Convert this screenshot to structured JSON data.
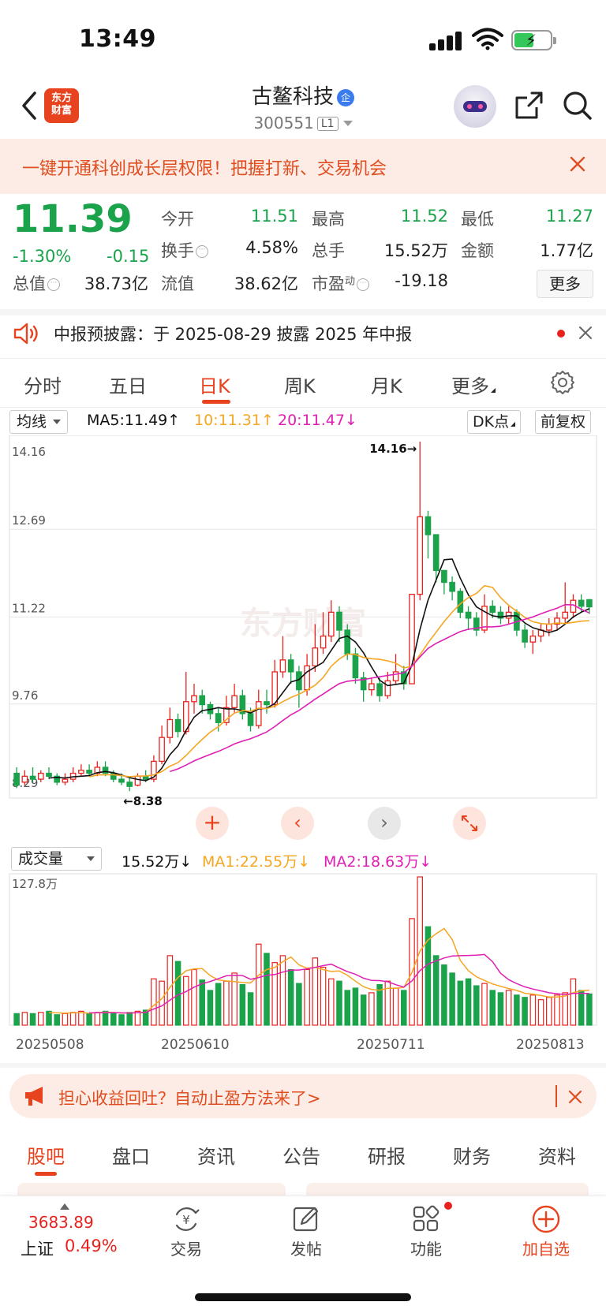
{
  "status_bar": {
    "time": "13:49"
  },
  "header": {
    "logo_text_1": "东方",
    "logo_text_2": "财富",
    "stock_name": "古鳌科技",
    "badge": "企",
    "stock_code": "300551",
    "level": "L1"
  },
  "promo": {
    "text": "一键开通科创成长层权限！把握打新、交易机会"
  },
  "quote": {
    "price": "11.39",
    "change_pct": "-1.30%",
    "change_abs": "-0.15",
    "fields": [
      {
        "label": "今开",
        "value": "11.51",
        "color": "green"
      },
      {
        "label": "最高",
        "value": "11.52",
        "color": "green"
      },
      {
        "label": "最低",
        "value": "11.27",
        "color": "green"
      },
      {
        "label": "换手",
        "value": "4.58%",
        "color": "dark"
      },
      {
        "label": "总手",
        "value": "15.52万",
        "color": "dark"
      },
      {
        "label": "金额",
        "value": "1.77亿",
        "color": "dark"
      },
      {
        "label": "总值",
        "value": "38.73亿",
        "color": "dark"
      },
      {
        "label": "流值",
        "value": "38.62亿",
        "color": "dark"
      },
      {
        "label": "市盈",
        "label_sup": "动",
        "value": "-19.18",
        "color": "dark"
      }
    ],
    "more_label": "更多"
  },
  "notice": {
    "text": "中报预披露：于 2025-08-29 披露 2025 年中报"
  },
  "tabs": [
    "分时",
    "五日",
    "日K",
    "周K",
    "月K",
    "更多"
  ],
  "active_tab": "日K",
  "chart_controls": {
    "indicator_select": "均线",
    "ma5": "MA5:11.49",
    "ma10": "10:11.31",
    "ma20": "20:11.47",
    "dk_button": "DK点",
    "adjust_button": "前复权",
    "volume_select": "成交量",
    "vol_value": "15.52万",
    "vol_ma1": "MA1:22.55万",
    "vol_ma2": "MA2:18.63万",
    "watermark": "东方财富"
  },
  "chart_data": {
    "type": "candlestick",
    "y_ticks": [
      "14.16",
      "12.69",
      "11.22",
      "9.76",
      "8.29"
    ],
    "ylim": [
      8.29,
      14.16
    ],
    "high_label": "14.16",
    "low_label": "8.38",
    "volume_max_label": "127.8万",
    "x_ticks": [
      "20250508",
      "20250610",
      "20250711",
      "20250813"
    ],
    "ohlc": [
      [
        8.6,
        8.4,
        8.7,
        8.35
      ],
      [
        8.45,
        8.55,
        8.65,
        8.4
      ],
      [
        8.55,
        8.5,
        8.7,
        8.45
      ],
      [
        8.5,
        8.6,
        8.65,
        8.45
      ],
      [
        8.6,
        8.55,
        8.7,
        8.5
      ],
      [
        8.55,
        8.45,
        8.6,
        8.4
      ],
      [
        8.45,
        8.5,
        8.6,
        8.4
      ],
      [
        8.5,
        8.6,
        8.7,
        8.45
      ],
      [
        8.6,
        8.65,
        8.75,
        8.55
      ],
      [
        8.65,
        8.6,
        8.75,
        8.55
      ],
      [
        8.6,
        8.7,
        8.8,
        8.55
      ],
      [
        8.7,
        8.6,
        8.8,
        8.55
      ],
      [
        8.6,
        8.5,
        8.65,
        8.45
      ],
      [
        8.5,
        8.45,
        8.6,
        8.4
      ],
      [
        8.45,
        8.38,
        8.55,
        8.3
      ],
      [
        8.4,
        8.55,
        8.6,
        8.38
      ],
      [
        8.55,
        8.5,
        8.65,
        8.45
      ],
      [
        8.5,
        8.8,
        8.9,
        8.45
      ],
      [
        8.8,
        9.2,
        9.4,
        8.75
      ],
      [
        9.2,
        9.5,
        9.7,
        9.1
      ],
      [
        9.5,
        9.3,
        9.6,
        9.2
      ],
      [
        9.3,
        9.8,
        10.3,
        9.25
      ],
      [
        9.8,
        9.9,
        10.1,
        9.6
      ],
      [
        9.9,
        9.75,
        10.0,
        9.6
      ],
      [
        9.75,
        9.6,
        9.8,
        9.5
      ],
      [
        9.6,
        9.45,
        9.7,
        9.3
      ],
      [
        9.45,
        9.7,
        9.9,
        9.4
      ],
      [
        9.7,
        9.9,
        10.1,
        9.6
      ],
      [
        9.9,
        9.6,
        10.0,
        9.5
      ],
      [
        9.6,
        9.4,
        9.7,
        9.3
      ],
      [
        9.4,
        9.8,
        10.0,
        9.35
      ],
      [
        9.8,
        9.75,
        10.0,
        9.6
      ],
      [
        9.75,
        10.3,
        10.5,
        9.7
      ],
      [
        10.3,
        10.5,
        10.9,
        10.2
      ],
      [
        10.5,
        10.3,
        10.6,
        10.1
      ],
      [
        10.3,
        10.0,
        10.4,
        9.7
      ],
      [
        10.0,
        10.4,
        10.6,
        9.9
      ],
      [
        10.4,
        10.7,
        11.1,
        10.3
      ],
      [
        10.7,
        10.9,
        11.3,
        10.6
      ],
      [
        10.9,
        11.3,
        11.5,
        10.8
      ],
      [
        11.3,
        11.0,
        11.4,
        10.8
      ],
      [
        11.0,
        10.6,
        11.1,
        10.5
      ],
      [
        10.6,
        10.2,
        10.7,
        10.1
      ],
      [
        10.2,
        10.0,
        10.3,
        9.8
      ],
      [
        10.0,
        10.1,
        10.2,
        9.9
      ],
      [
        10.1,
        9.9,
        10.2,
        9.8
      ],
      [
        9.9,
        10.15,
        10.3,
        9.85
      ],
      [
        10.15,
        10.3,
        10.6,
        10.1
      ],
      [
        10.3,
        10.1,
        10.4,
        10.0
      ],
      [
        10.1,
        11.6,
        11.6,
        10.1
      ],
      [
        11.6,
        12.9,
        14.16,
        11.5
      ],
      [
        12.9,
        12.6,
        13.0,
        12.2
      ],
      [
        12.6,
        12.0,
        12.2,
        11.8
      ],
      [
        12.0,
        11.8,
        12.0,
        11.6
      ],
      [
        11.8,
        11.65,
        11.9,
        11.5
      ],
      [
        11.65,
        11.3,
        11.7,
        11.2
      ],
      [
        11.3,
        11.2,
        11.4,
        11.0
      ],
      [
        11.2,
        11.0,
        11.3,
        10.9
      ],
      [
        11.0,
        11.4,
        11.6,
        10.95
      ],
      [
        11.4,
        11.3,
        11.5,
        11.2
      ],
      [
        11.3,
        11.2,
        11.4,
        11.1
      ],
      [
        11.2,
        11.3,
        11.4,
        11.1
      ],
      [
        11.3,
        11.0,
        11.35,
        10.9
      ],
      [
        11.0,
        10.8,
        11.1,
        10.7
      ],
      [
        10.8,
        10.9,
        11.0,
        10.6
      ],
      [
        10.9,
        11.0,
        11.1,
        10.8
      ],
      [
        11.0,
        11.1,
        11.2,
        10.9
      ],
      [
        11.1,
        11.2,
        11.3,
        11.0
      ],
      [
        11.2,
        11.3,
        11.8,
        11.1
      ],
      [
        11.3,
        11.5,
        11.6,
        11.2
      ],
      [
        11.5,
        11.4,
        11.6,
        11.3
      ],
      [
        11.51,
        11.39,
        11.52,
        11.27
      ]
    ],
    "volume": [
      10,
      11,
      10,
      11,
      12,
      9,
      10,
      11,
      12,
      10,
      11,
      12,
      10,
      9,
      11,
      12,
      13,
      40,
      38,
      60,
      55,
      42,
      48,
      39,
      30,
      36,
      38,
      45,
      35,
      28,
      70,
      62,
      54,
      60,
      48,
      36,
      48,
      58,
      50,
      40,
      38,
      30,
      32,
      26,
      28,
      35,
      38,
      32,
      30,
      92,
      128,
      85,
      60,
      52,
      45,
      38,
      40,
      34,
      36,
      30,
      28,
      30,
      26,
      24,
      26,
      22,
      24,
      26,
      28,
      40,
      30,
      27
    ]
  },
  "chart_buttons": [
    "zoom-in",
    "prev",
    "next",
    "expand"
  ],
  "ad": {
    "text": "担心收益回吐？自动止盈方法来了>"
  },
  "bottom_tabs": [
    "股吧",
    "盘口",
    "资讯",
    "公告",
    "研报",
    "财务",
    "资料"
  ],
  "footer": {
    "index_value": "3683.89",
    "index_name": "上证",
    "index_pct": "0.49%",
    "items": [
      {
        "icon": "trade-icon",
        "label": "交易"
      },
      {
        "icon": "post-icon",
        "label": "发帖"
      },
      {
        "icon": "function-icon",
        "label": "功能"
      },
      {
        "icon": "add-watchlist-icon",
        "label": "加自选"
      }
    ]
  },
  "colors": {
    "brand": "#e8431f",
    "up": "#e8231f",
    "down": "#1aa34a",
    "ma5": "#111111",
    "ma10": "#f5a623",
    "ma20": "#e020b4"
  }
}
